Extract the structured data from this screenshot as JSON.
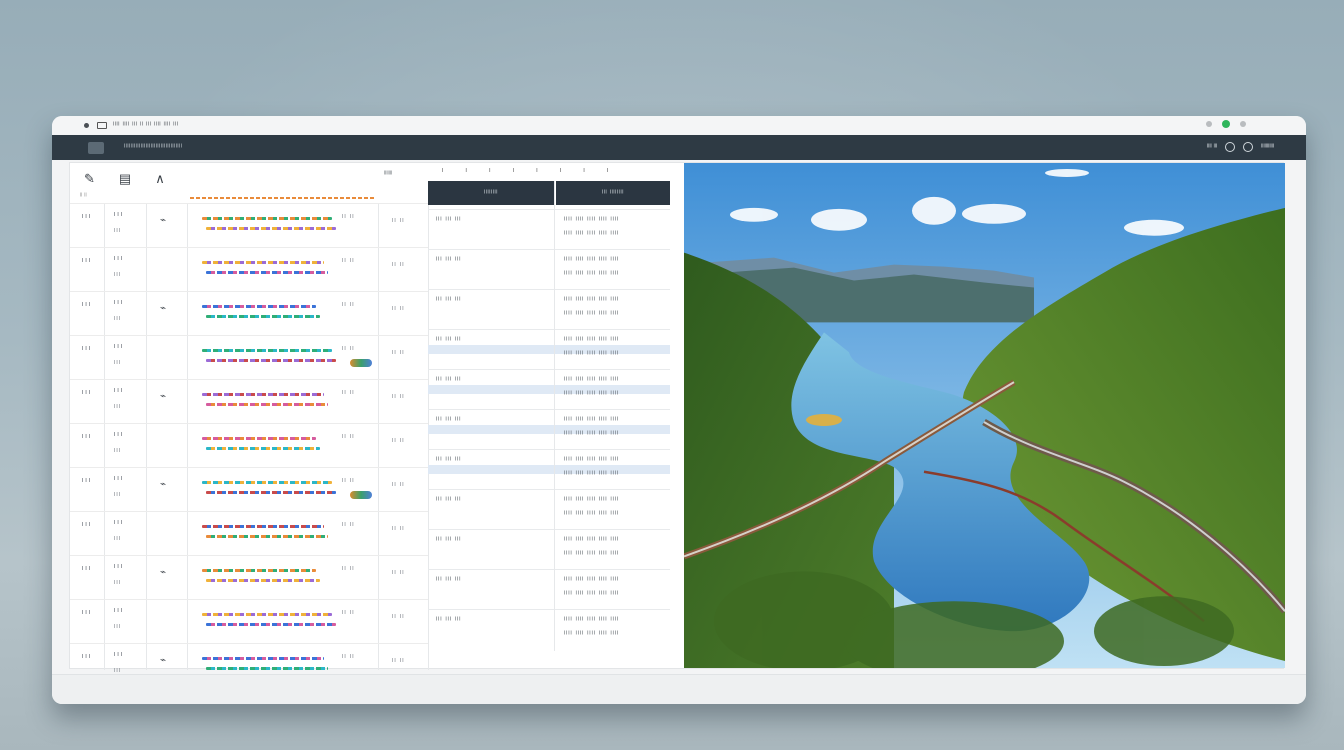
{
  "window": {
    "title_text": "ᴵᴵᴵᴵ ᴵᴵᴵᴵ ᴵᴵᴵ ᴵᴵ ᴵᴵᴵ ᴵᴵᴵᴵ ᴵᴵᴵᴵ ᴵᴵᴵ",
    "appbar_title": "ᴵᴵᴵᴵᴵᴵᴵᴵᴵᴵᴵᴵᴵᴵᴵᴵᴵᴵᴵᴵᴵᴵᴵᴵᴵᴵᴵᴵᴵᴵᴵᴵᴵᴵᴵ",
    "appbar_right": "ᴵᴵᴵᴵ ᴵᴵᴵ",
    "appbar_right2": "ᴵᴵᴵᴵᴵᴵᴵᴵᴵᴵᴵ"
  },
  "toolbar": {
    "icons": [
      "pen-icon",
      "image-icon",
      "chart-icon"
    ],
    "mini_label": "ᴵᴵᴵᴵᴵᴵᴵ",
    "col_labels": "ᴵ ᴵ ᴵ ᴵ ᴵ ᴵ ᴵ ᴵ"
  },
  "table": {
    "headers": [
      "ᴵᴵᴵᴵᴵᴵᴵᴵ",
      "ᴵᴵᴵ ᴵᴵᴵᴵᴵᴵᴵᴵ"
    ],
    "row_codes": [
      "ᴵᴵᴵ",
      "ᴵᴵᴵ",
      "ᴵᴵᴵ",
      "ᴵᴵᴵ",
      "ᴵᴵᴵ",
      "ᴵᴵᴵ",
      "ᴵᴵᴵ",
      "ᴵᴵᴵ",
      "ᴵᴵᴵ",
      "ᴵᴵᴵ",
      "ᴵᴵᴵ"
    ],
    "cell_text": "ᴵᴵᴵ ᴵᴵᴵ ᴵᴵᴵ",
    "cell_text_long": "ᴵᴵᴵᴵ ᴵᴵᴵᴵ ᴵᴵᴵᴵ ᴵᴵᴵᴵ ᴵᴵᴵᴵ",
    "cell_small": "ᴵᴵ ᴵᴵ"
  },
  "colors": {
    "accent": "#2e3a44",
    "orange": "#e98b3a",
    "green": "#2fb55b",
    "stripe_palette": [
      "#e98b3a",
      "#f0b23a",
      "#3b73d8",
      "#2fae77",
      "#9b6bd6",
      "#d65c9e",
      "#2bb7c8",
      "#c94b4b"
    ]
  },
  "image": {
    "alt": "landscape-photo"
  }
}
